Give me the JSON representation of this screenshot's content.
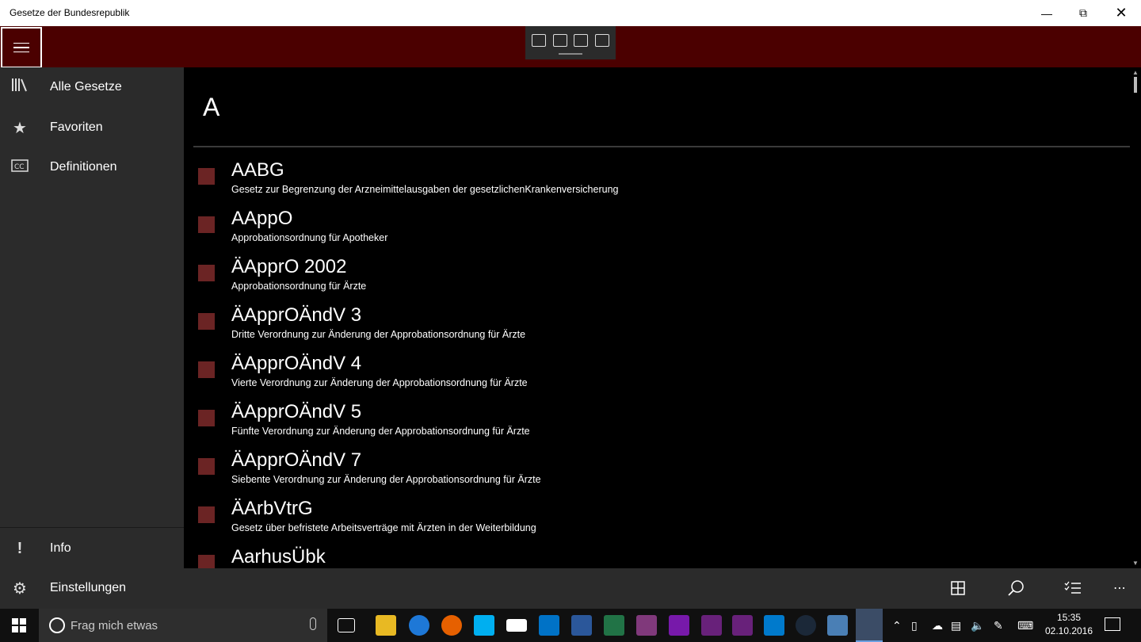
{
  "window": {
    "title": "Gesetze der Bundesrepublik"
  },
  "sidebar": {
    "items": [
      {
        "label": "Alle Gesetze",
        "icon": "library-icon"
      },
      {
        "label": "Favoriten",
        "icon": "star-icon"
      },
      {
        "label": "Definitionen",
        "icon": "closed-caption-icon"
      }
    ],
    "bottom": [
      {
        "label": "Info",
        "icon": "exclamation-icon"
      },
      {
        "label": "Einstellungen",
        "icon": "gear-icon"
      }
    ]
  },
  "main": {
    "group_header": "A",
    "items": [
      {
        "title": "AABG",
        "subtitle": "Gesetz zur Begrenzung der Arzneimittelausgaben der gesetzlichenKrankenversicherung"
      },
      {
        "title": "AAppO",
        "subtitle": "Approbationsordnung für Apotheker"
      },
      {
        "title": "ÄApprO 2002",
        "subtitle": "Approbationsordnung für Ärzte"
      },
      {
        "title": "ÄApprOÄndV 3",
        "subtitle": "Dritte Verordnung zur Änderung der Approbationsordnung für Ärzte"
      },
      {
        "title": "ÄApprOÄndV 4",
        "subtitle": "Vierte Verordnung zur Änderung der Approbationsordnung für Ärzte"
      },
      {
        "title": "ÄApprOÄndV 5",
        "subtitle": "Fünfte Verordnung zur Änderung der Approbationsordnung für Ärzte"
      },
      {
        "title": "ÄApprOÄndV 7",
        "subtitle": "Siebente Verordnung zur Änderung der Approbationsordnung für Ärzte"
      },
      {
        "title": "ÄArbVtrG",
        "subtitle": "Gesetz über befristete Arbeitsverträge mit Ärzten in der Weiterbildung"
      },
      {
        "title": "AarhusÜbk",
        "subtitle": ""
      }
    ]
  },
  "taskbar": {
    "search_placeholder": "Frag mich etwas",
    "time": "15:35",
    "date": "02.10.2016"
  },
  "colors": {
    "accent": "#4b0000",
    "item_square": "#6b2424",
    "sidebar": "#2b2b2b"
  }
}
